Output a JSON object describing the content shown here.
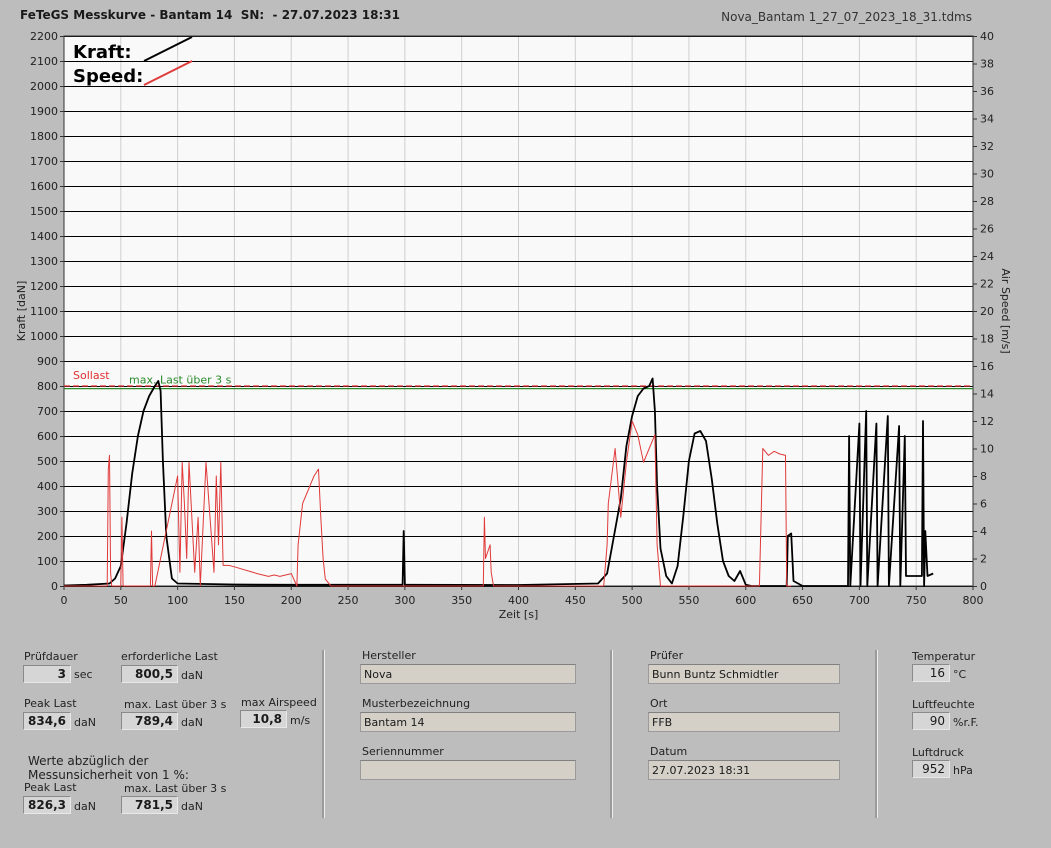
{
  "header": {
    "title": "FeTeGS Messkurve - Bantam 14  SN:  - 27.07.2023 18:31",
    "filename": "Nova_Bantam 1_27_07_2023_18_31.tdms"
  },
  "chart_data": {
    "type": "line",
    "xlabel": "Zeit [s]",
    "ylabel": "Kraft [daN]",
    "y2label": "Air Speed [m/s]",
    "xlim": [
      0,
      800
    ],
    "ylim": [
      0,
      2200
    ],
    "y2lim": [
      0,
      40
    ],
    "xticks": [
      0,
      50,
      100,
      150,
      200,
      250,
      300,
      350,
      400,
      450,
      500,
      550,
      600,
      650,
      700,
      750,
      800
    ],
    "yticks": [
      0,
      100,
      200,
      300,
      400,
      500,
      600,
      700,
      800,
      900,
      1000,
      1100,
      1200,
      1300,
      1400,
      1500,
      1600,
      1700,
      1800,
      1900,
      2000,
      2100,
      2200
    ],
    "y2ticks": [
      0,
      2,
      4,
      6,
      8,
      10,
      12,
      14,
      16,
      18,
      20,
      22,
      24,
      26,
      28,
      30,
      32,
      34,
      36,
      38,
      40
    ],
    "grid": true,
    "legend": [
      "Kraft:",
      "Speed:"
    ],
    "legend_position": "top-left",
    "reference_lines": [
      {
        "name": "Sollast",
        "y": 800,
        "color": "#e03030",
        "style": "dashed"
      },
      {
        "name": "max. Last über  3 s",
        "y": 789.4,
        "color": "#2a8a2a",
        "style": "solid"
      }
    ],
    "series": [
      {
        "name": "Kraft",
        "axis": "left",
        "color": "#000000",
        "x": [
          0,
          20,
          40,
          45,
          50,
          55,
          60,
          65,
          70,
          75,
          80,
          83,
          85,
          87,
          90,
          95,
          100,
          150,
          200,
          298,
          299,
          300,
          301,
          302,
          400,
          470,
          478,
          482,
          490,
          495,
          500,
          505,
          510,
          515,
          518,
          520,
          522,
          525,
          530,
          535,
          540,
          545,
          550,
          555,
          560,
          565,
          570,
          575,
          580,
          585,
          590,
          595,
          600,
          605,
          620,
          636,
          637,
          640,
          642,
          650,
          690,
          691,
          692,
          700,
          701,
          706,
          707,
          715,
          716,
          725,
          726,
          735,
          736,
          740,
          741,
          755,
          756,
          757,
          758,
          760,
          765
        ],
        "y": [
          2,
          5,
          10,
          30,
          80,
          250,
          450,
          600,
          700,
          760,
          800,
          820,
          780,
          500,
          200,
          30,
          10,
          6,
          5,
          5,
          220,
          5,
          5,
          5,
          4,
          10,
          50,
          150,
          350,
          560,
          680,
          760,
          790,
          800,
          830,
          700,
          400,
          150,
          40,
          10,
          80,
          280,
          500,
          610,
          620,
          580,
          430,
          250,
          100,
          40,
          20,
          60,
          5,
          0,
          0,
          0,
          200,
          210,
          20,
          0,
          0,
          600,
          0,
          650,
          0,
          700,
          0,
          650,
          0,
          680,
          0,
          640,
          0,
          600,
          40,
          40,
          660,
          0,
          220,
          40,
          50
        ]
      },
      {
        "name": "Speed",
        "axis": "right",
        "color": "#e03a3a",
        "x": [
          0,
          38,
          39,
          40,
          41,
          42,
          50,
          51,
          52,
          55,
          76,
          77,
          78,
          80,
          100,
          102,
          104,
          106,
          108,
          110,
          115,
          118,
          120,
          125,
          132,
          134,
          136,
          138,
          140,
          142,
          145,
          150,
          170,
          175,
          180,
          185,
          190,
          195,
          200,
          205,
          206,
          210,
          215,
          220,
          224,
          226,
          228,
          230,
          235,
          300,
          369,
          370,
          371,
          375,
          376,
          378,
          380,
          475,
          478,
          479,
          485,
          490,
          495,
          500,
          505,
          510,
          515,
          520,
          522,
          525,
          530,
          548,
          549,
          550,
          555,
          600,
          610,
          612,
          615,
          620,
          625,
          630,
          635,
          636,
          640
        ],
        "y": [
          0,
          0,
          8.5,
          9.5,
          1,
          0,
          0,
          5,
          0,
          0,
          0,
          4,
          0,
          0,
          8,
          1,
          9,
          6,
          2,
          9,
          1,
          5,
          0,
          9,
          1,
          8,
          3,
          9,
          1.5,
          1.5,
          1.5,
          1.4,
          0.9,
          0.8,
          0.7,
          0.8,
          0.7,
          0.8,
          0.9,
          0,
          3,
          6,
          7,
          8,
          8.5,
          5,
          2,
          0.5,
          0,
          0,
          0,
          5,
          2,
          3,
          1,
          0,
          0,
          0,
          3,
          6,
          10,
          5,
          9,
          12,
          11,
          9,
          10,
          11,
          3,
          0,
          0,
          0,
          0,
          0,
          0,
          0,
          0,
          0,
          10,
          9.5,
          9.8,
          9.6,
          9.5,
          0,
          0
        ]
      }
    ]
  },
  "summary": {
    "pruefdauer": {
      "label": "Prüfdauer",
      "value": "3",
      "unit": "sec"
    },
    "erforderliche_last": {
      "label": "erforderliche Last",
      "value": "800,5",
      "unit": "daN"
    },
    "peak_last": {
      "label": "Peak Last",
      "value": "834,6",
      "unit": "daN"
    },
    "max_last": {
      "label": "max. Last über  3 s",
      "value": "789,4",
      "unit": "daN"
    },
    "max_airspeed": {
      "label": "max Airspeed",
      "value": "10,8",
      "unit": "m/s"
    },
    "werte_note_1": "Werte abzüglich der",
    "werte_note_2": "Messunsicherheit von 1  %:",
    "peak_last_adj": {
      "label": "Peak Last",
      "value": "826,3",
      "unit": "daN"
    },
    "max_last_adj": {
      "label": "max. Last über  3 s",
      "value": "781,5",
      "unit": "daN"
    }
  },
  "info": {
    "hersteller": {
      "label": "Hersteller",
      "value": "Nova"
    },
    "muster": {
      "label": "Musterbezeichnung",
      "value": "Bantam 14"
    },
    "serien": {
      "label": "Seriennummer",
      "value": ""
    },
    "pruefer": {
      "label": "Prüfer",
      "value": "Bunn Buntz Schmidtler"
    },
    "ort": {
      "label": "Ort",
      "value": "FFB"
    },
    "datum": {
      "label": "Datum",
      "value": "27.07.2023 18:31"
    }
  },
  "env": {
    "temperatur": {
      "label": "Temperatur",
      "value": "16",
      "unit": "°C"
    },
    "luftfeuchte": {
      "label": "Luftfeuchte",
      "value": "90",
      "unit": "%r.F."
    },
    "luftdruck": {
      "label": "Luftdruck",
      "value": "952",
      "unit": "hPa"
    }
  },
  "colors": {
    "plot_bg": "#f9f9f9",
    "kraft": "#000000",
    "speed": "#e03a3a",
    "sollast": "#e03030",
    "maxlast": "#2a8a2a"
  }
}
